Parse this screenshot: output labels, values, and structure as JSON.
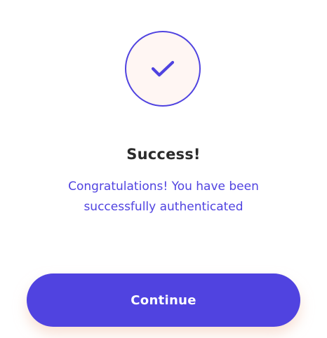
{
  "success": {
    "icon": "check-icon",
    "title": "Success!",
    "message": "Congratulations! You have been successfully authenticated"
  },
  "actions": {
    "continue_label": "Continue"
  },
  "colors": {
    "accent": "#5043e0",
    "badge_background": "#fff6f3",
    "title": "#2b2b2b",
    "button_text": "#ffffff"
  }
}
